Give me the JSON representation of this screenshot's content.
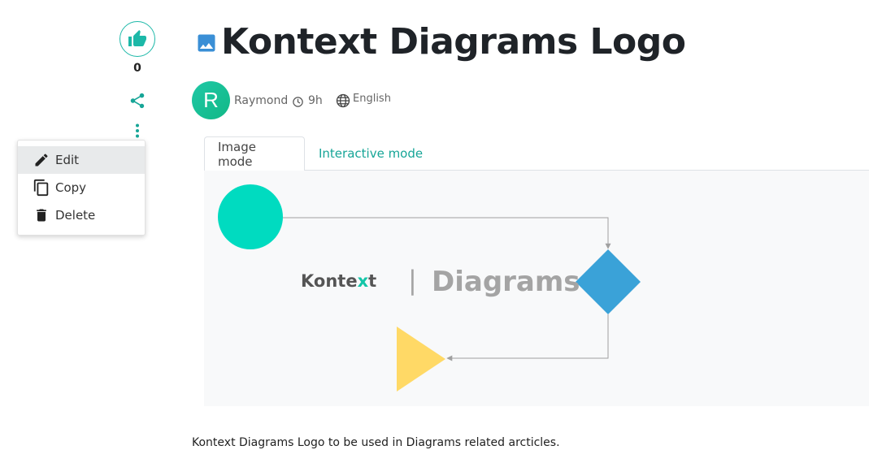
{
  "page": {
    "title": "Kontext Diagrams Logo",
    "description": "Kontext Diagrams Logo to be used in Diagrams related arcticles."
  },
  "sidebar": {
    "like_count": "0",
    "like_icon": "thumbs-up-icon",
    "share_icon": "share-icon",
    "more_icon": "more-vertical-icon"
  },
  "menu": {
    "items": [
      {
        "label": "Edit",
        "icon": "pencil-icon"
      },
      {
        "label": "Copy",
        "icon": "copy-icon"
      },
      {
        "label": "Delete",
        "icon": "trash-icon"
      }
    ]
  },
  "author": {
    "initial": "R",
    "name": "Raymond",
    "time": "9h",
    "language": "English"
  },
  "tabs": [
    {
      "label": "Image mode",
      "active": true
    },
    {
      "label": "Interactive mode",
      "active": false
    }
  ],
  "diagram": {
    "logo_part1": "Konte",
    "logo_x": "x",
    "logo_part2": "t",
    "separator": "|",
    "logo_word": "Diagrams",
    "colors": {
      "circle": "#00dbc0",
      "diamond": "#3aa2d8",
      "triangle": "#ffd966",
      "connector": "#a0a0a0"
    }
  },
  "colors": {
    "accent": "#16a597",
    "avatar": "#12b886",
    "title": "#1f2328"
  }
}
